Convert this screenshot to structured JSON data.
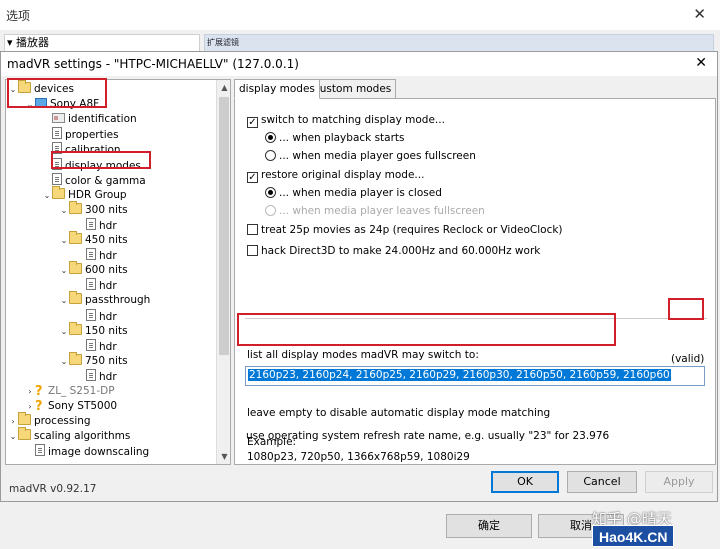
{
  "background_window": {
    "title": "选项",
    "combo": "▾ 播放器",
    "strip": "扩展滤镜",
    "ok_label": "确定",
    "cancel_label": "取消"
  },
  "dialog": {
    "title": "madVR settings - \"HTPC-MICHAELLV\" (127.0.0.1)",
    "version": "madVR v0.92.17",
    "buttons": {
      "ok": "OK",
      "cancel": "Cancel",
      "apply": "Apply"
    }
  },
  "tree": {
    "items": [
      {
        "label": "devices",
        "icon": "folder-icon",
        "expand": "⌄",
        "level": 0
      },
      {
        "label": "Sony A8F",
        "icon": "monitor-icon",
        "expand": "⌄",
        "level": 1
      },
      {
        "label": "identification",
        "icon": "id-card-icon",
        "expand": "",
        "level": 2
      },
      {
        "label": "properties",
        "icon": "document-icon",
        "expand": "",
        "level": 2
      },
      {
        "label": "calibration",
        "icon": "document-icon",
        "expand": "",
        "level": 2
      },
      {
        "label": "display modes",
        "icon": "document-icon",
        "expand": "",
        "level": 2,
        "selected": true
      },
      {
        "label": "color & gamma",
        "icon": "document-icon",
        "expand": "",
        "level": 2
      },
      {
        "label": "HDR Group",
        "icon": "folder-icon",
        "expand": "⌄",
        "level": 2
      },
      {
        "label": "300 nits",
        "icon": "folder-icon",
        "expand": "⌄",
        "level": 3
      },
      {
        "label": "hdr",
        "icon": "document-icon",
        "expand": "",
        "level": 4
      },
      {
        "label": "450 nits",
        "icon": "folder-icon",
        "expand": "⌄",
        "level": 3
      },
      {
        "label": "hdr",
        "icon": "document-icon",
        "expand": "",
        "level": 4
      },
      {
        "label": "600 nits",
        "icon": "folder-icon",
        "expand": "⌄",
        "level": 3
      },
      {
        "label": "hdr",
        "icon": "document-icon",
        "expand": "",
        "level": 4
      },
      {
        "label": "passthrough",
        "icon": "folder-icon",
        "expand": "⌄",
        "level": 3
      },
      {
        "label": "hdr",
        "icon": "document-icon",
        "expand": "",
        "level": 4
      },
      {
        "label": "150 nits",
        "icon": "folder-icon",
        "expand": "⌄",
        "level": 3
      },
      {
        "label": "hdr",
        "icon": "document-icon",
        "expand": "",
        "level": 4
      },
      {
        "label": "750 nits",
        "icon": "folder-icon",
        "expand": "⌄",
        "level": 3
      },
      {
        "label": "hdr",
        "icon": "document-icon",
        "expand": "",
        "level": 4
      },
      {
        "label": "ZL_ S251-DP",
        "icon": "question-icon",
        "expand": "›",
        "level": 1,
        "gray": true
      },
      {
        "label": "Sony ST5000",
        "icon": "question-icon",
        "expand": "›",
        "level": 1
      },
      {
        "label": "processing",
        "icon": "folder-icon",
        "expand": "›",
        "level": 0
      },
      {
        "label": "scaling algorithms",
        "icon": "folder-icon",
        "expand": "⌄",
        "level": 0
      },
      {
        "label": "image downscaling",
        "icon": "document-icon",
        "expand": "",
        "level": 1
      }
    ]
  },
  "tabs": {
    "display_modes": "display modes",
    "custom_modes": "custom modes"
  },
  "options": {
    "switch_matching": "switch to matching display mode...",
    "on_playback_starts": "... when playback starts",
    "on_fullscreen": "... when media player goes fullscreen",
    "restore_original": "restore original display mode...",
    "on_player_closed": "... when media player is closed",
    "on_leaves_fullscreen": "... when media player leaves fullscreen",
    "treat_25p": "treat 25p movies as 24p  (requires Reclock or VideoClock)",
    "hack_direct3d": "hack Direct3D to make 24.000Hz and 60.000Hz work"
  },
  "modes": {
    "label": "list all display modes madVR may switch to:",
    "status": "(valid)",
    "value": "2160p23, 2160p24, 2160p25, 2160p29, 2160p30, 2160p50, 2160p59, 2160p60",
    "hint": "leave empty to disable automatic display mode matching",
    "example_label": "Example:",
    "example_value": "1080p23, 720p50, 1366x768p59, 1080i29",
    "refresh_hint": "use operating system refresh rate name, e.g. usually \"23\" for 23.976"
  },
  "watermark": {
    "text": "知乎 @晴天",
    "logo": "Hao4K.CN"
  },
  "colors": {
    "highlight": "#d11f2a",
    "selection": "#0078d7"
  }
}
